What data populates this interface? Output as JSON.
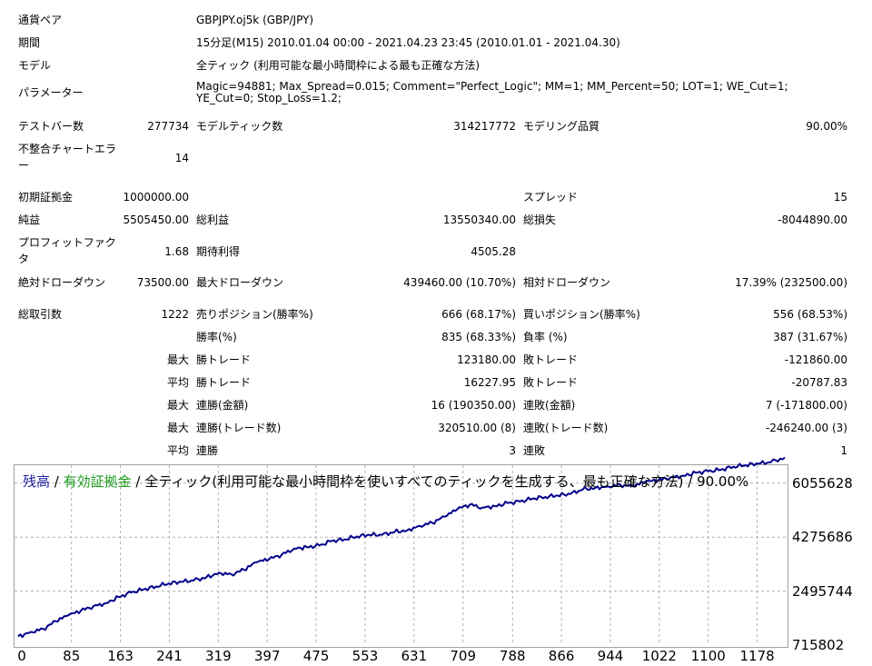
{
  "report": {
    "symbol_label": "通貨ペア",
    "symbol_value": "GBPJPY.oj5k (GBP/JPY)",
    "period_label": "期間",
    "period_value": "15分足(M15) 2010.01.04 00:00 - 2021.04.23 23:45 (2010.01.01 - 2021.04.30)",
    "model_label": "モデル",
    "model_value": "全ティック (利用可能な最小時間枠による最も正確な方法)",
    "params_label": "パラメーター",
    "params_value": "Magic=94881; Max_Spread=0.015; Comment=\"Perfect_Logic\"; MM=1; MM_Percent=50; LOT=1; WE_Cut=1; YE_Cut=0; Stop_Loss=1.2;",
    "bars_label": "テストバー数",
    "bars_value": "277734",
    "ticks_label": "モデルティック数",
    "ticks_value": "314217772",
    "quality_label": "モデリング品質",
    "quality_value": "90.00%",
    "mismatch_label": "不整合チャートエラー",
    "mismatch_value": "14",
    "deposit_label": "初期証拠金",
    "deposit_value": "1000000.00",
    "spread_label": "スプレッド",
    "spread_value": "15",
    "net_label": "純益",
    "net_value": "5505450.00",
    "gross_profit_label": "総利益",
    "gross_profit_value": "13550340.00",
    "gross_loss_label": "総損失",
    "gross_loss_value": "-8044890.00",
    "pf_label": "プロフィットファクタ",
    "pf_value": "1.68",
    "expected_label": "期待利得",
    "expected_value": "4505.28",
    "abs_dd_label": "絶対ドローダウン",
    "abs_dd_value": "73500.00",
    "max_dd_label": "最大ドローダウン",
    "max_dd_value": "439460.00 (10.70%)",
    "rel_dd_label": "相対ドローダウン",
    "rel_dd_value": "17.39% (232500.00)",
    "trades_label": "総取引数",
    "trades_value": "1222",
    "short_label": "売りポジション(勝率%)",
    "short_value": "666 (68.17%)",
    "long_label": "買いポジション(勝率%)",
    "long_value": "556 (68.53%)",
    "winrate_label": "勝率(%)",
    "winrate_value": "835 (68.33%)",
    "lossrate_label": "負率 (%)",
    "lossrate_value": "387 (31.67%)",
    "max_label": "最大",
    "avg_label": "平均",
    "largest_win_label": "勝トレード",
    "largest_win_value": "123180.00",
    "largest_loss_label": "敗トレード",
    "largest_loss_value": "-121860.00",
    "avg_win_label": "勝トレード",
    "avg_win_value": "16227.95",
    "avg_loss_label": "敗トレード",
    "avg_loss_value": "-20787.83",
    "max_cons_wins_label": "連勝(金額)",
    "max_cons_wins_value": "16 (190350.00)",
    "max_cons_losses_label": "連敗(金額)",
    "max_cons_losses_value": "7 (-171800.00)",
    "max_cons_profit_label": "連勝(トレード数)",
    "max_cons_profit_value": "320510.00 (8)",
    "max_cons_loss_label": "連敗(トレード数)",
    "max_cons_loss_value": "-246240.00 (3)",
    "avg_cons_wins_label": "連勝",
    "avg_cons_wins_value": "3",
    "avg_cons_losses_label": "連敗",
    "avg_cons_losses_value": "1"
  },
  "chart_title": {
    "balance": "残高",
    "sep1": " / ",
    "equity": "有効証拠金",
    "rest": " / 全ティック(利用可能な最小時間枠を使いすべてのティックを生成する、最も正確な方法) / 90.00%"
  },
  "colors": {
    "balance": "#1f1fa0",
    "equity": "#1a9a1a",
    "line": "#00008b",
    "grid": "#b0b0b0"
  },
  "chart_data": {
    "type": "line",
    "title": "残高 / 有効証拠金 / 全ティック(利用可能な最小時間枠を使いすべてのティックを生成する、最も正確な方法) / 90.00%",
    "x_ticks": [
      0,
      85,
      163,
      241,
      319,
      397,
      475,
      553,
      631,
      709,
      788,
      866,
      944,
      1022,
      1100,
      1178
    ],
    "y_ticks": [
      715802,
      2495744,
      4275686,
      6055628
    ],
    "xlim": [
      0,
      1222
    ],
    "ylim": [
      715802,
      6648942
    ],
    "grid": true,
    "series": [
      {
        "name": "残高",
        "x": [
          0,
          20,
          40,
          60,
          80,
          100,
          120,
          140,
          160,
          180,
          200,
          220,
          240,
          260,
          280,
          300,
          320,
          340,
          360,
          380,
          400,
          420,
          440,
          460,
          480,
          500,
          520,
          540,
          560,
          580,
          600,
          620,
          640,
          660,
          680,
          700,
          720,
          740,
          760,
          780,
          800,
          820,
          840,
          860,
          880,
          900,
          920,
          940,
          960,
          980,
          1000,
          1020,
          1040,
          1060,
          1080,
          1100,
          1120,
          1140,
          1160,
          1180,
          1200,
          1222
        ],
        "values": [
          1000000,
          1150000,
          1250000,
          1500000,
          1700000,
          1850000,
          2000000,
          2100000,
          2300000,
          2450000,
          2550000,
          2650000,
          2750000,
          2800000,
          2850000,
          2950000,
          3100000,
          3050000,
          3200000,
          3450000,
          3550000,
          3700000,
          3900000,
          3950000,
          4000000,
          4150000,
          4200000,
          4300000,
          4350000,
          4350000,
          4450000,
          4500000,
          4650000,
          4750000,
          4950000,
          5200000,
          5350000,
          5250000,
          5300000,
          5400000,
          5450000,
          5550000,
          5600000,
          5650000,
          5700000,
          5850000,
          5900000,
          5950000,
          6000000,
          5950000,
          6100000,
          6150000,
          6250000,
          6300000,
          6400000,
          6450000,
          6500000,
          6600000,
          6650000,
          6700000,
          6750000,
          6900000
        ]
      }
    ]
  }
}
